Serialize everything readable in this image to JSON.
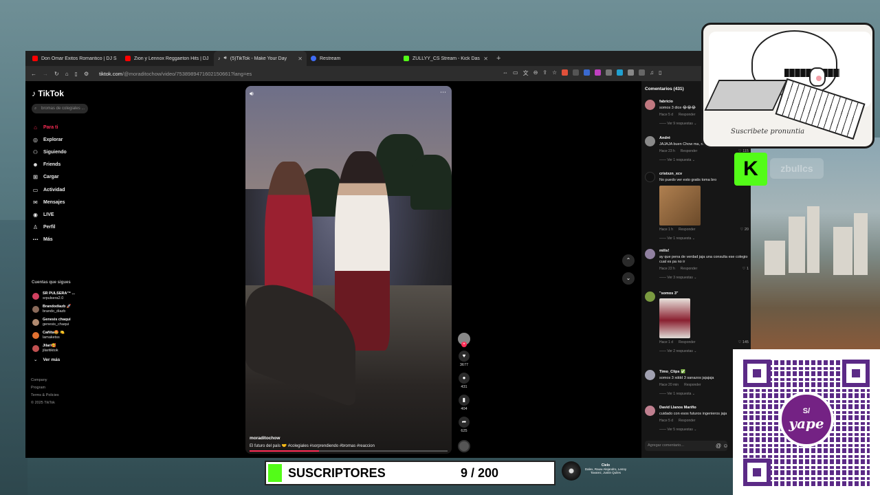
{
  "browser": {
    "tabs": [
      {
        "title": "Don Omar Exitos Romantico | DJ San",
        "color": "#ff0000",
        "closable": false
      },
      {
        "title": "Zion y Lennox Reggaeton Hits | DJ S",
        "color": "#ff0000",
        "closable": false
      },
      {
        "title": "(5)TikTok - Make Your Day",
        "color": "#ffffff",
        "closable": true,
        "active": true
      },
      {
        "title": "Restream",
        "color": "#3f6cf5",
        "closable": false
      },
      {
        "title": "ZULLYY_CS Stream - Kick Dashbo",
        "color": "#53fc18",
        "closable": true
      }
    ],
    "new_tab": "+",
    "url_host": "tiktok.com",
    "url_path": "/@moraditochow/video/7538989471602150661?lang=es"
  },
  "tiktok": {
    "logo": "TikTok",
    "search_placeholder": "bromas de colegiales ...",
    "nav": [
      {
        "label": "Para ti",
        "icon": "home-icon",
        "glyph": "⌂",
        "active": true
      },
      {
        "label": "Explorar",
        "icon": "compass-icon",
        "glyph": "◎"
      },
      {
        "label": "Siguiendo",
        "icon": "following-icon",
        "glyph": "⚇"
      },
      {
        "label": "Friends",
        "icon": "friends-icon",
        "glyph": "☻"
      },
      {
        "label": "Cargar",
        "icon": "upload-icon",
        "glyph": "⊞"
      },
      {
        "label": "Actividad",
        "icon": "activity-icon",
        "glyph": "▭"
      },
      {
        "label": "Mensajes",
        "icon": "messages-icon",
        "glyph": "✉"
      },
      {
        "label": "LIVE",
        "icon": "live-icon",
        "glyph": "◉"
      },
      {
        "label": "Perfil",
        "icon": "profile-icon",
        "glyph": "♙"
      },
      {
        "label": "Más",
        "icon": "more-icon",
        "glyph": "⋯"
      }
    ],
    "following_title": "Cuentas que sigues",
    "following": [
      {
        "name": "SR PULSERA™ ...",
        "handle": "srpulsera2.0",
        "color": "#d04060"
      },
      {
        "name": "Brandodiazb 🚀",
        "handle": "brando_diazb",
        "color": "#8a6a5a"
      },
      {
        "name": "Genesis chaqui",
        "handle": "genesis_chaqui",
        "color": "#b08a70"
      },
      {
        "name": "Cañita🤩 🍋",
        "handle": "lamaketss",
        "color": "#e07030"
      },
      {
        "name": "Jilari🥰",
        "handle": "jilaritiktok",
        "color": "#c05050"
      }
    ],
    "see_more": "Ver más",
    "footer": [
      "Company",
      "Program",
      "Terms & Policies",
      "© 2025 TikTok"
    ]
  },
  "video": {
    "author": "moraditochow",
    "caption": "El futuro del país 🤝 #colegiales #sorprendiendo #bromas #reaccion",
    "progress": 0.35,
    "likes": "3677",
    "comments_count": "431",
    "saves": "404",
    "shares": "625"
  },
  "comments": {
    "title": "Comentarios (431)",
    "items": [
      {
        "user": "fabricio",
        "text": "somos 3 dice 😂😂😂",
        "time": "Hace 5 d",
        "reply": "Responder",
        "replies": "Ver 9 respuestas",
        "likes": "",
        "color": "#c07880"
      },
      {
        "user": "André",
        "text": "JAJAJA buen Chow ma, ni gane el follow",
        "time": "Hace 23 h",
        "reply": "Responder",
        "replies": "Ver 1 respuesta",
        "likes": "115",
        "color": "#8a8a8a"
      },
      {
        "user": "cristxzn_xcv",
        "text": "No puedo ver esto gratis toma bro",
        "time": "Hace 1 h",
        "reply": "Responder",
        "replies": "Ver 1 respuesta",
        "likes": "20",
        "color": "#111111",
        "image": true
      },
      {
        "user": "milis!",
        "text": "ay que pena de verdad jaja una consulta ese colegio cual es pa no ir",
        "time": "Hace 22 h",
        "reply": "Responder",
        "replies": "Ver 3 respuestas",
        "likes": "1",
        "color": "#9080a0"
      },
      {
        "user": "\"somos 3\"",
        "text": "",
        "time": "Hace 1 d",
        "reply": "Responder",
        "replies": "Ver 2 respuestas",
        "likes": "145",
        "color": "#7a9a40",
        "image2": true
      },
      {
        "user": "Timo_Clips ✅",
        "text": "somos 3 xddd 3 sanazos jajajaja",
        "time": "Hace 20 min",
        "reply": "Responder",
        "replies": "Ver 1 respuesta",
        "likes": "",
        "color": "#a0a0b0"
      },
      {
        "user": "David Llanos Mariño",
        "text": "cuidado con esos futuros ingenieros jaja",
        "time": "Hace 5 d",
        "reply": "Responder",
        "replies": "Ver 5 respuestas",
        "likes": "",
        "color": "#c08090"
      }
    ],
    "input_placeholder": "Agregar comentario...",
    "at": "@",
    "emoji": "☺"
  },
  "overlay": {
    "signature": "Suscribete pronuntia",
    "kick_logo": "K",
    "kick_channel": "zbullcs",
    "qr_brand_s": "S/",
    "qr_brand": "yape",
    "subs_label": "SUSCRIPTORES",
    "subs_count": "9 / 200",
    "now_playing_title": "Cielo",
    "now_playing_sub": "Dalex, Rauw Alejandro, Lenny Tavarez, Justin Quiles"
  }
}
